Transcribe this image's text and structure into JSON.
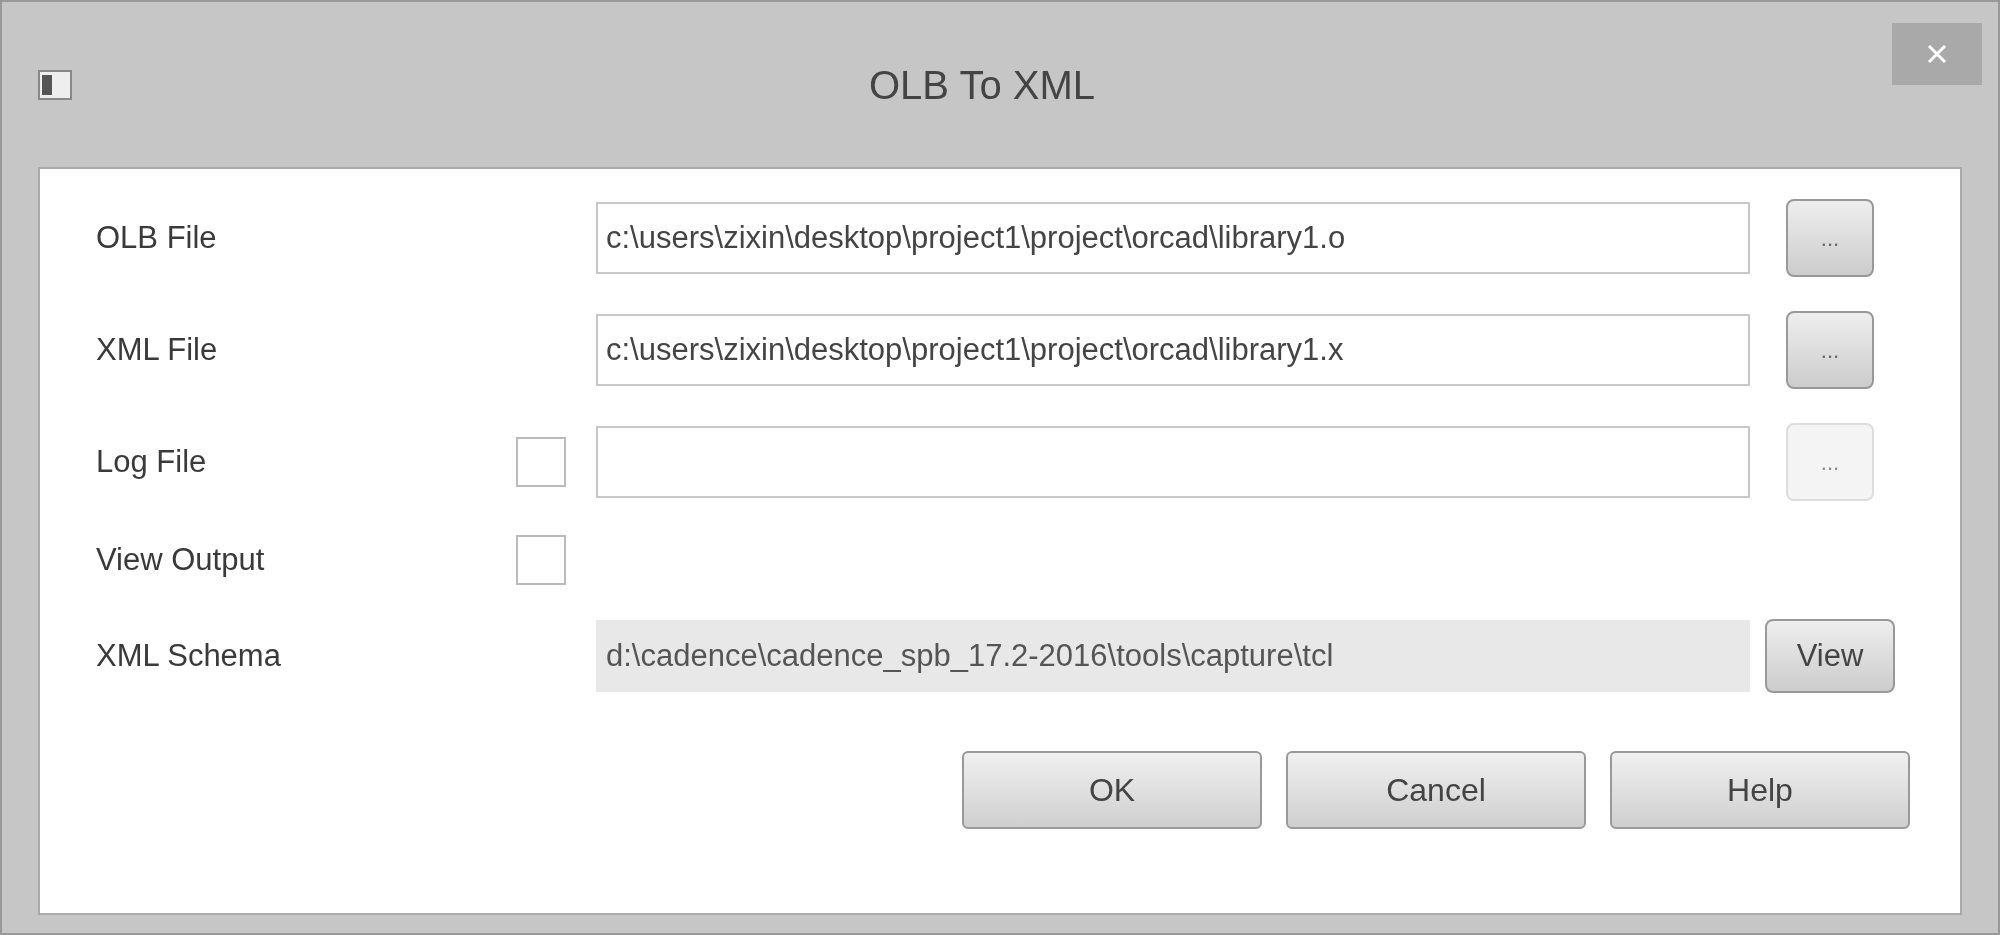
{
  "window": {
    "title": "OLB To XML"
  },
  "rows": [
    {
      "kind": "file",
      "label": "OLB File",
      "value": "c:\\users\\zixin\\desktop\\project1\\project\\orcad\\library1.o",
      "browse": "...",
      "browse_disabled": false
    },
    {
      "kind": "file",
      "label": "XML File",
      "value": "c:\\users\\zixin\\desktop\\project1\\project\\orcad\\library1.x",
      "browse": "...",
      "browse_disabled": false
    },
    {
      "kind": "file",
      "label": "Log File",
      "checked": false,
      "browse": "...",
      "browse_disabled": true
    },
    {
      "kind": "check",
      "label": "View Output",
      "checked": false
    },
    {
      "kind": "readonly",
      "label": "XML Schema",
      "value": "d:\\cadence\\cadence_spb_17.2-2016\\tools\\capture\\tcl",
      "browse": "View",
      "browse_disabled": false
    }
  ],
  "buttons": [
    {
      "label": "OK"
    },
    {
      "label": "Cancel"
    },
    {
      "label": "Help"
    }
  ]
}
